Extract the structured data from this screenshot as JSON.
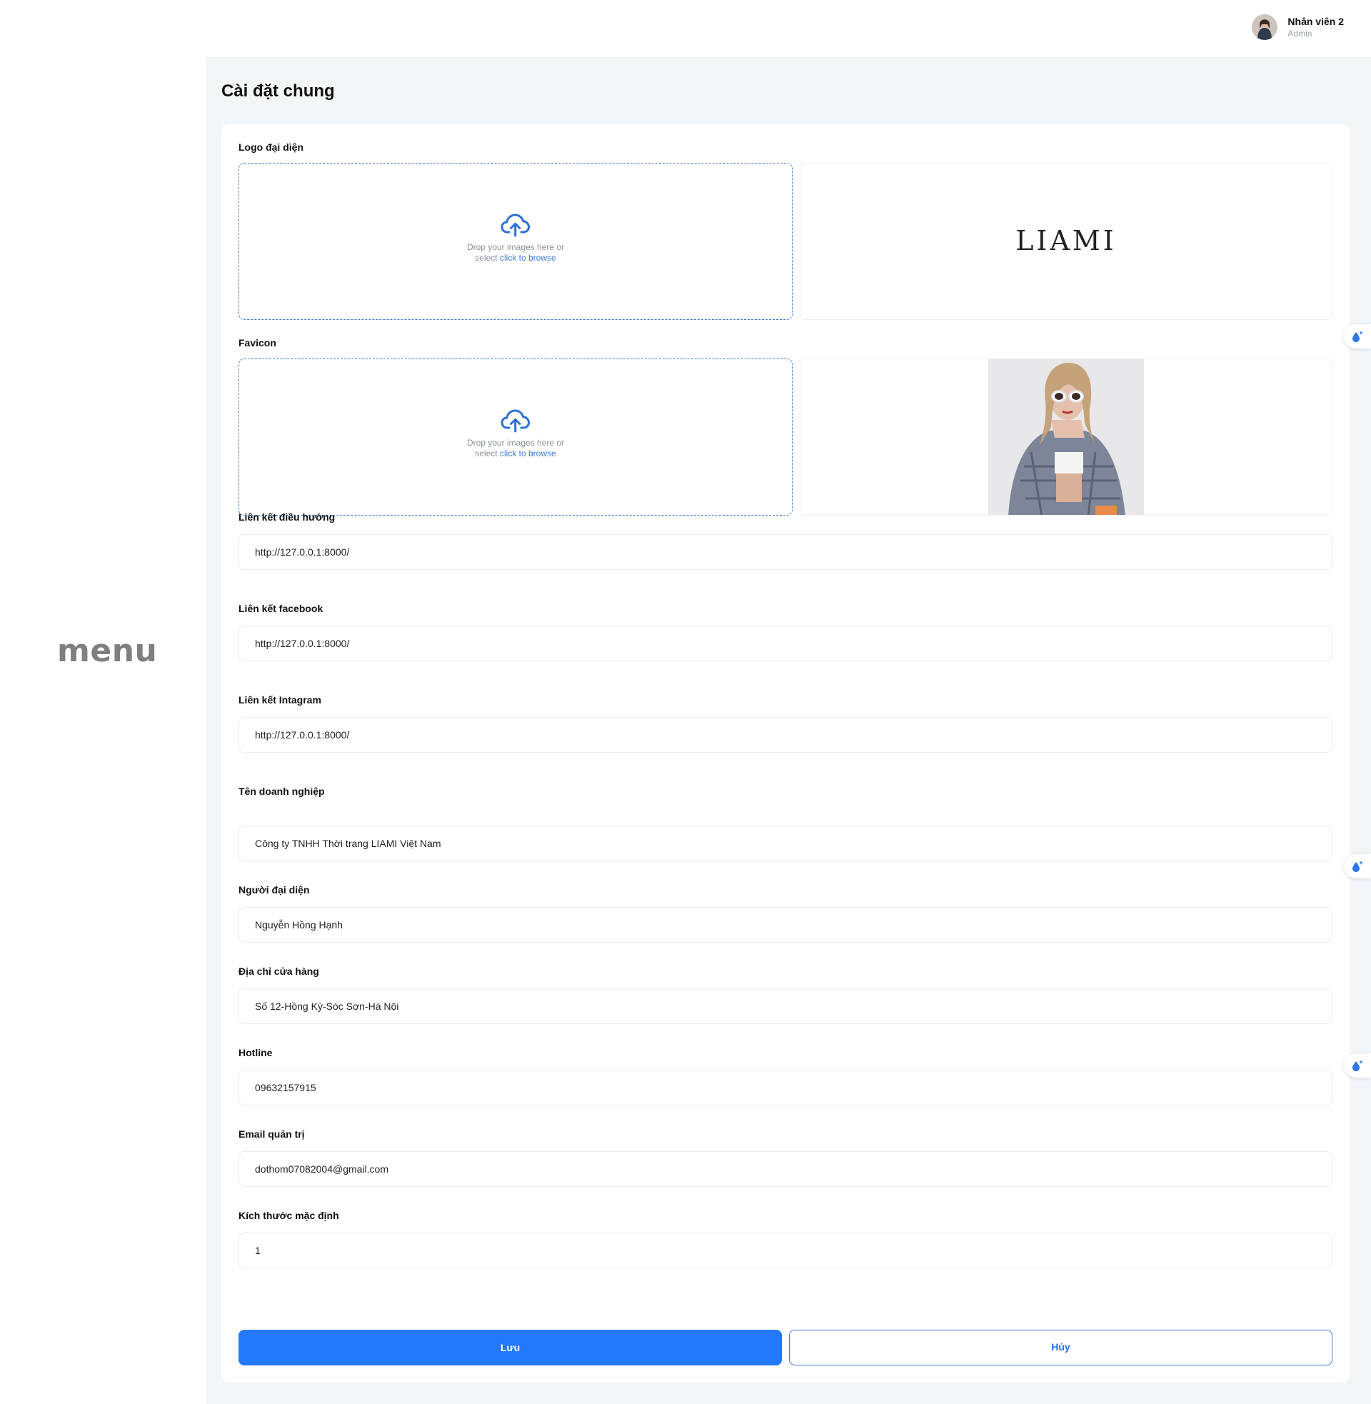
{
  "sidebar": {
    "menu_label": "menu"
  },
  "user": {
    "name": "Nhân viên 2",
    "role": "Admin"
  },
  "page": {
    "title": "Cài đặt chung"
  },
  "logo": {
    "label": "Logo đại diện",
    "drop_text": "Drop your images here or",
    "drop_select": "select",
    "drop_link": "click to browse",
    "preview_text": "LIAMI"
  },
  "favicon": {
    "label": "Favicon",
    "drop_text": "Drop your images here or",
    "drop_select": "select",
    "drop_link": "click to browse"
  },
  "fields": {
    "nav_link": {
      "label": "Liên kết điều hướng",
      "value": "http://127.0.0.1:8000/"
    },
    "facebook": {
      "label": "Liên kết facebook",
      "value": "http://127.0.0.1:8000/"
    },
    "instagram": {
      "label": "Liên kết Intagram",
      "value": "http://127.0.0.1:8000/"
    },
    "company": {
      "label": "Tên doanh nghiệp",
      "value": "Công ty TNHH Thời trang LIAMI Việt Nam"
    },
    "representative": {
      "label": "Người đại diện",
      "value": "Nguyễn Hồng Hạnh"
    },
    "address": {
      "label": "Địa chỉ cửa hàng",
      "value": "Số 12-Hồng Kỳ-Sóc Sơn-Hà Nội"
    },
    "hotline": {
      "label": "Hotline",
      "value": "09632157915"
    },
    "email": {
      "label": "Email quản trị",
      "value": "dothom07082004@gmail.com"
    },
    "default_size": {
      "label": "Kích thước mặc định",
      "value": "1"
    }
  },
  "actions": {
    "save": "Lưu",
    "cancel": "Hủy"
  },
  "colors": {
    "primary": "#2478fb",
    "page_bg": "#f2f6f9",
    "dropzone_border": "#3a7bd5",
    "menu_text": "#7f7f7f"
  },
  "icons": [
    "upload-cloud-icon",
    "floating-tool-icon"
  ]
}
